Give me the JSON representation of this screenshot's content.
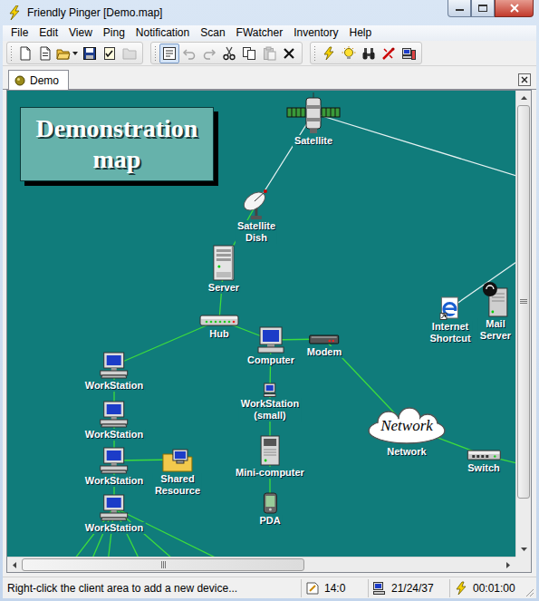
{
  "window": {
    "title": "Friendly Pinger [Demo.map]"
  },
  "menu": [
    "File",
    "Edit",
    "View",
    "Ping",
    "Notification",
    "Scan",
    "FWatcher",
    "Inventory",
    "Help"
  ],
  "toolbar": [
    [
      {
        "disabled": false,
        "pressed": false,
        "dropdown": false
      },
      {
        "disabled": false,
        "pressed": false,
        "dropdown": false
      },
      {
        "disabled": false,
        "pressed": false,
        "dropdown": true
      },
      {
        "disabled": false,
        "pressed": false,
        "dropdown": false
      },
      {
        "disabled": false,
        "pressed": false,
        "dropdown": false
      },
      {
        "disabled": true,
        "pressed": false,
        "dropdown": false
      }
    ],
    [
      {
        "disabled": false,
        "pressed": true,
        "dropdown": false
      },
      {
        "disabled": true,
        "pressed": false,
        "dropdown": false
      },
      {
        "disabled": true,
        "pressed": false,
        "dropdown": false
      },
      {
        "disabled": false,
        "pressed": false,
        "dropdown": false
      },
      {
        "disabled": false,
        "pressed": false,
        "dropdown": false
      },
      {
        "disabled": true,
        "pressed": false,
        "dropdown": false
      },
      {
        "disabled": false,
        "pressed": false,
        "dropdown": false
      }
    ],
    [
      {
        "disabled": false,
        "pressed": false,
        "dropdown": false
      },
      {
        "disabled": false,
        "pressed": false,
        "dropdown": false
      },
      {
        "disabled": false,
        "pressed": false,
        "dropdown": false
      },
      {
        "disabled": false,
        "pressed": false,
        "dropdown": false
      },
      {
        "disabled": false,
        "pressed": false,
        "dropdown": false
      }
    ]
  ],
  "tabs": [
    {
      "label": "Demo",
      "selected": true
    }
  ],
  "map": {
    "title": "Demonstration\nmap",
    "nodes": [
      {
        "label": "Satellite",
        "kind": "satellite"
      },
      {
        "label": "Satellite\nDish",
        "kind": "dish"
      },
      {
        "label": "Server",
        "kind": "server"
      },
      {
        "label": "Hub",
        "kind": "hub"
      },
      {
        "label": "Computer",
        "kind": "computer"
      },
      {
        "label": "Modem",
        "kind": "modem"
      },
      {
        "label": "WorkStation",
        "kind": "workstation"
      },
      {
        "label": "WorkStation",
        "kind": "workstation"
      },
      {
        "label": "WorkStation",
        "kind": "workstation"
      },
      {
        "label": "Shared\nResource",
        "kind": "folder"
      },
      {
        "label": "WorkStation",
        "kind": "workstation"
      },
      {
        "label": "WorkStation\n(small)",
        "kind": "smallpc"
      },
      {
        "label": "Mini-computer",
        "kind": "minicomputer"
      },
      {
        "label": "PDA",
        "kind": "pda"
      },
      {
        "label": "Network",
        "kind": "cloud",
        "inner": "Network"
      },
      {
        "label": "Switch",
        "kind": "switch"
      },
      {
        "label": "Internet\nShortcut",
        "kind": "ie"
      },
      {
        "label": "Mail\nServer",
        "kind": "mailserver"
      }
    ],
    "links": [
      {
        "from": 0,
        "to": 1,
        "color": "#e6f2f2"
      },
      {
        "from": 1,
        "to": 2,
        "color": "#3ddc3d"
      },
      {
        "from": 2,
        "to": 3,
        "color": "#3ddc3d"
      },
      {
        "from": 3,
        "to": 6,
        "color": "#3ddc3d"
      },
      {
        "from": 3,
        "to": 4,
        "color": "#3ddc3d"
      },
      {
        "from": 4,
        "to": 5,
        "color": "#3ddc3d"
      },
      {
        "from": 5,
        "to": 14,
        "color": "#3ddc3d"
      },
      {
        "from": 14,
        "to": 15,
        "color": "#3ddc3d"
      },
      {
        "from": 4,
        "to": 11,
        "color": "#3ddc3d"
      },
      {
        "from": 11,
        "to": 12,
        "color": "#3ddc3d"
      },
      {
        "from": 12,
        "to": 13,
        "color": "#3ddc3d"
      },
      {
        "from": 6,
        "to": 7,
        "color": "#3ddc3d"
      },
      {
        "from": 7,
        "to": 8,
        "color": "#3ddc3d"
      },
      {
        "from": 8,
        "to": 9,
        "color": "#3ddc3d"
      },
      {
        "from": 8,
        "to": 10,
        "color": "#3ddc3d"
      },
      {
        "from": 0,
        "to": null,
        "color": "#e6f2f2"
      },
      {
        "from": 16,
        "to": null,
        "color": "#e6f2f2"
      },
      {
        "from": 15,
        "to": null,
        "color": "#3ddc3d"
      },
      {
        "from": 10,
        "to": null,
        "color": "#3ddc3d"
      },
      {
        "from": 10,
        "to": null,
        "color": "#3ddc3d"
      },
      {
        "from": 10,
        "to": null,
        "color": "#3ddc3d"
      },
      {
        "from": 10,
        "to": null,
        "color": "#3ddc3d"
      },
      {
        "from": 10,
        "to": null,
        "color": "#3ddc3d"
      },
      {
        "from": 10,
        "to": null,
        "color": "#3ddc3d"
      }
    ]
  },
  "scrollbars": {
    "horizontal": {
      "size": 0.59
    },
    "vertical": {
      "size": 0.9
    }
  },
  "status_bar": {
    "hint": "Right-click the client area to add a new device...",
    "fields": [
      "14:0",
      "21/24/37",
      "00:01:00"
    ]
  }
}
